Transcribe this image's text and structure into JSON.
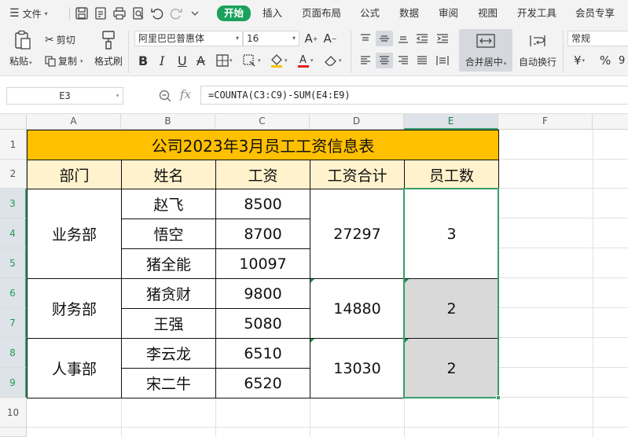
{
  "menu": {
    "file_label": "文件",
    "tabs": [
      "开始",
      "插入",
      "页面布局",
      "公式",
      "数据",
      "审阅",
      "视图",
      "开发工具",
      "会员专享"
    ]
  },
  "ribbon": {
    "paste": "粘贴",
    "cut": "剪切",
    "copy": "复制",
    "format_painter": "格式刷",
    "font_name": "阿里巴巴普惠体",
    "font_size": "16",
    "merge_center": "合并居中",
    "wrap_text": "自动换行",
    "number_format": "常规",
    "currency_symbol": "¥",
    "percent_symbol": "%"
  },
  "formula_bar": {
    "cell_ref": "E3",
    "fx": "fx",
    "formula": "=COUNTA(C3:C9)-SUM(E4:E9)"
  },
  "sheet": {
    "columns": [
      "A",
      "B",
      "C",
      "D",
      "E",
      "F"
    ],
    "rows": [
      "1",
      "2",
      "3",
      "4",
      "5",
      "6",
      "7",
      "8",
      "9",
      "10"
    ],
    "title": "公司2023年3月员工工资信息表",
    "headers": [
      "部门",
      "姓名",
      "工资",
      "工资合计",
      "员工数"
    ],
    "departments": [
      {
        "name": "业务部",
        "total": "27297",
        "count": "3",
        "employees": [
          {
            "name": "赵飞",
            "salary": "8500"
          },
          {
            "name": "悟空",
            "salary": "8700"
          },
          {
            "name": "猪全能",
            "salary": "10097"
          }
        ]
      },
      {
        "name": "财务部",
        "total": "14880",
        "count": "2",
        "employees": [
          {
            "name": "猪贪财",
            "salary": "9800"
          },
          {
            "name": "王强",
            "salary": "5080"
          }
        ]
      },
      {
        "name": "人事部",
        "total": "13030",
        "count": "2",
        "employees": [
          {
            "name": "李云龙",
            "salary": "6510"
          },
          {
            "name": "宋二牛",
            "salary": "6520"
          }
        ]
      }
    ]
  },
  "colors": {
    "accent_green": "#1aa15c",
    "title_fill": "#ffc000",
    "header_fill": "#fff2cc",
    "selected_fill": "#d9d9d9"
  }
}
